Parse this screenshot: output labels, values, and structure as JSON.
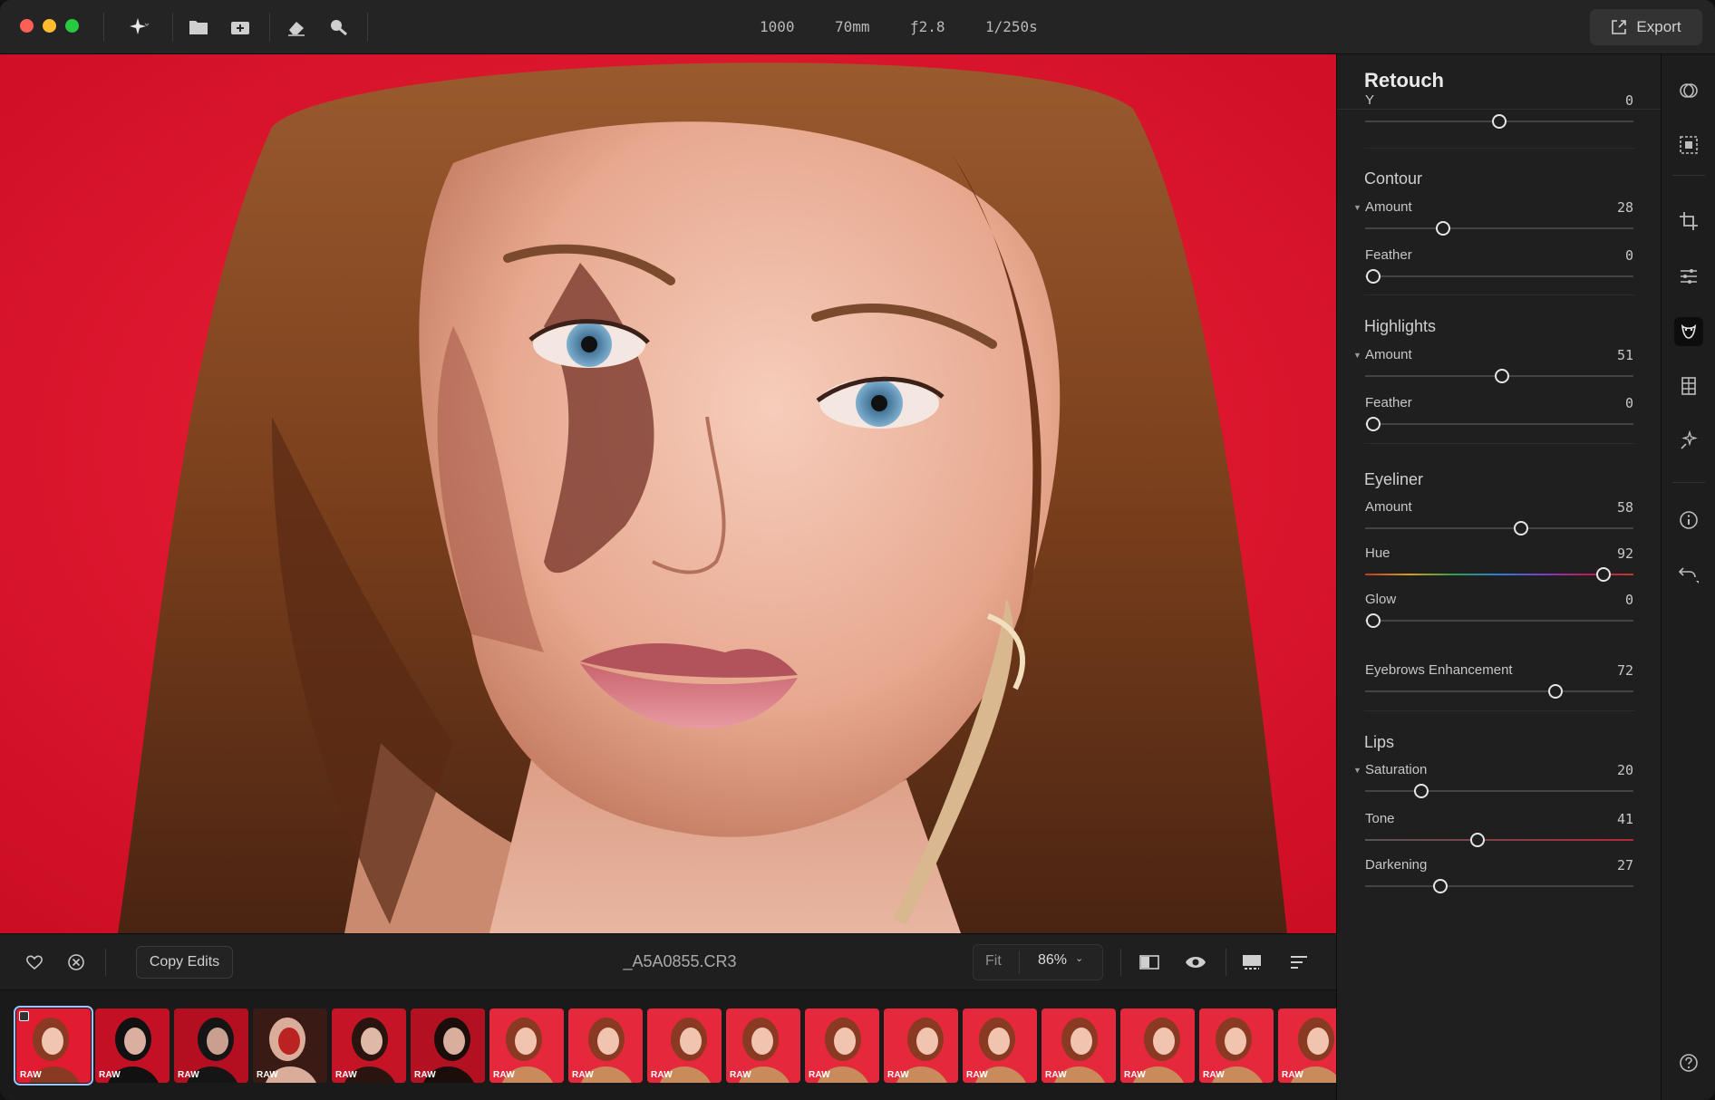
{
  "window": {
    "title": ""
  },
  "toolbar": {
    "exif": {
      "iso": "1000",
      "focal": "70mm",
      "aperture": "ƒ2.8",
      "shutter": "1/250s"
    },
    "export_label": "Export"
  },
  "panel": {
    "title": "Retouch",
    "top_slider": {
      "label": "Y",
      "value": "0",
      "level": 0.5
    },
    "sections": [
      {
        "name": "Contour",
        "sliders": [
          {
            "label": "Amount",
            "value": "28",
            "level": 0.29,
            "caret": true
          },
          {
            "label": "Feather",
            "value": "0",
            "level": 0.03
          }
        ]
      },
      {
        "name": "Highlights",
        "sliders": [
          {
            "label": "Amount",
            "value": "51",
            "level": 0.51,
            "caret": true
          },
          {
            "label": "Feather",
            "value": "0",
            "level": 0.03
          }
        ]
      },
      {
        "name": "Eyeliner",
        "sliders": [
          {
            "label": "Amount",
            "value": "58",
            "level": 0.58
          },
          {
            "label": "Hue",
            "value": "92",
            "level": 0.89,
            "rainbow": true
          },
          {
            "label": "Glow",
            "value": "0",
            "level": 0.03
          },
          {
            "label": "Eyebrows Enhancement",
            "value": "72",
            "level": 0.71
          }
        ]
      },
      {
        "name": "Lips",
        "sliders": [
          {
            "label": "Saturation",
            "value": "20",
            "level": 0.21,
            "caret": true
          },
          {
            "label": "Tone",
            "value": "41",
            "level": 0.42,
            "redtrack": true
          },
          {
            "label": "Darkening",
            "value": "27",
            "level": 0.28
          }
        ]
      }
    ]
  },
  "bottom_bar": {
    "copy_edits": "Copy Edits",
    "filename": "_A5A0855.CR3",
    "fit": "Fit",
    "zoom": "86%"
  },
  "filmstrip": {
    "badge": "RAW",
    "count": 17,
    "selected_index": 0
  },
  "colors": {
    "backdrop_red": "#e0142b",
    "panel_bg": "#1f1f1f",
    "titlebar_bg": "#242424",
    "traffic_red": "#fe5f57",
    "traffic_yellow": "#febc2e",
    "traffic_green": "#28c840"
  }
}
